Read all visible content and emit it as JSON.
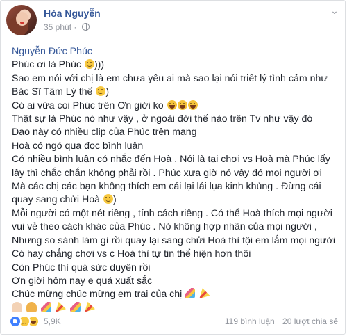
{
  "post": {
    "author": "Hòa Nguyễn",
    "time": "35 phút",
    "more_icon": "chevron-down-icon",
    "privacy_icon": "globe-icon"
  },
  "content": {
    "mention": "Nguyễn Đức Phúc",
    "lines": [
      "Phúc ơi là Phúc",
      "Sao em nói với chị là em chưa yêu ai mà sao lại nói triết lý tình cảm như",
      "Bác Sĩ Tâm Lý thế",
      "Có ai vừa coi Phúc trên Ơn giời ko",
      "Thật sự là Phúc nó như vậy , ở ngoài đời thế nào trên Tv như vậy đó",
      "Dạo này có nhiều clip của Phúc trên mạng",
      "Hoà có ngó qua đọc bình luận",
      "Có nhiều bình luận có nhắc đến Hoà . Nói là tại chơi vs Hoà mà Phúc lấy",
      "lây thì chắc chắn không phải rồi . Phúc xưa giờ nó vậy đó mọi người ơi",
      "Mà các chị các bạn không thích em cái lại lái lụa kinh khủng . Đừng cái",
      "quay sang chửi Hoà",
      "Mỗi người có một nét riêng , tính cách riêng . Có thể Hoà thích mọi người",
      "vui vẻ theo cách khác của Phúc . Nó không hợp nhãn của mọi người ,",
      "Nhưng so sánh làm gì rồi quay lại sang chửi Hoà thì tội em lắm mọi người",
      "Có hay chẳng chơi vs c Hoà thì tự tin thể hiện hơn thôi",
      "Còn Phúc thì quá sức duyên rồi",
      "Ơn giời hôm nay e quá xuất sắc",
      "Chúc mừng chúc mừng em trai của chị"
    ],
    "line0_suffix": ")))",
    "line2_suffix": ")",
    "line10_suffix": ")"
  },
  "footer": {
    "reaction_count": "5,9K",
    "comments": "119 bình luận",
    "shares": "20 lượt chia sẻ"
  },
  "colors": {
    "link": "#365899",
    "text": "#1d2129",
    "meta": "#90949c"
  }
}
